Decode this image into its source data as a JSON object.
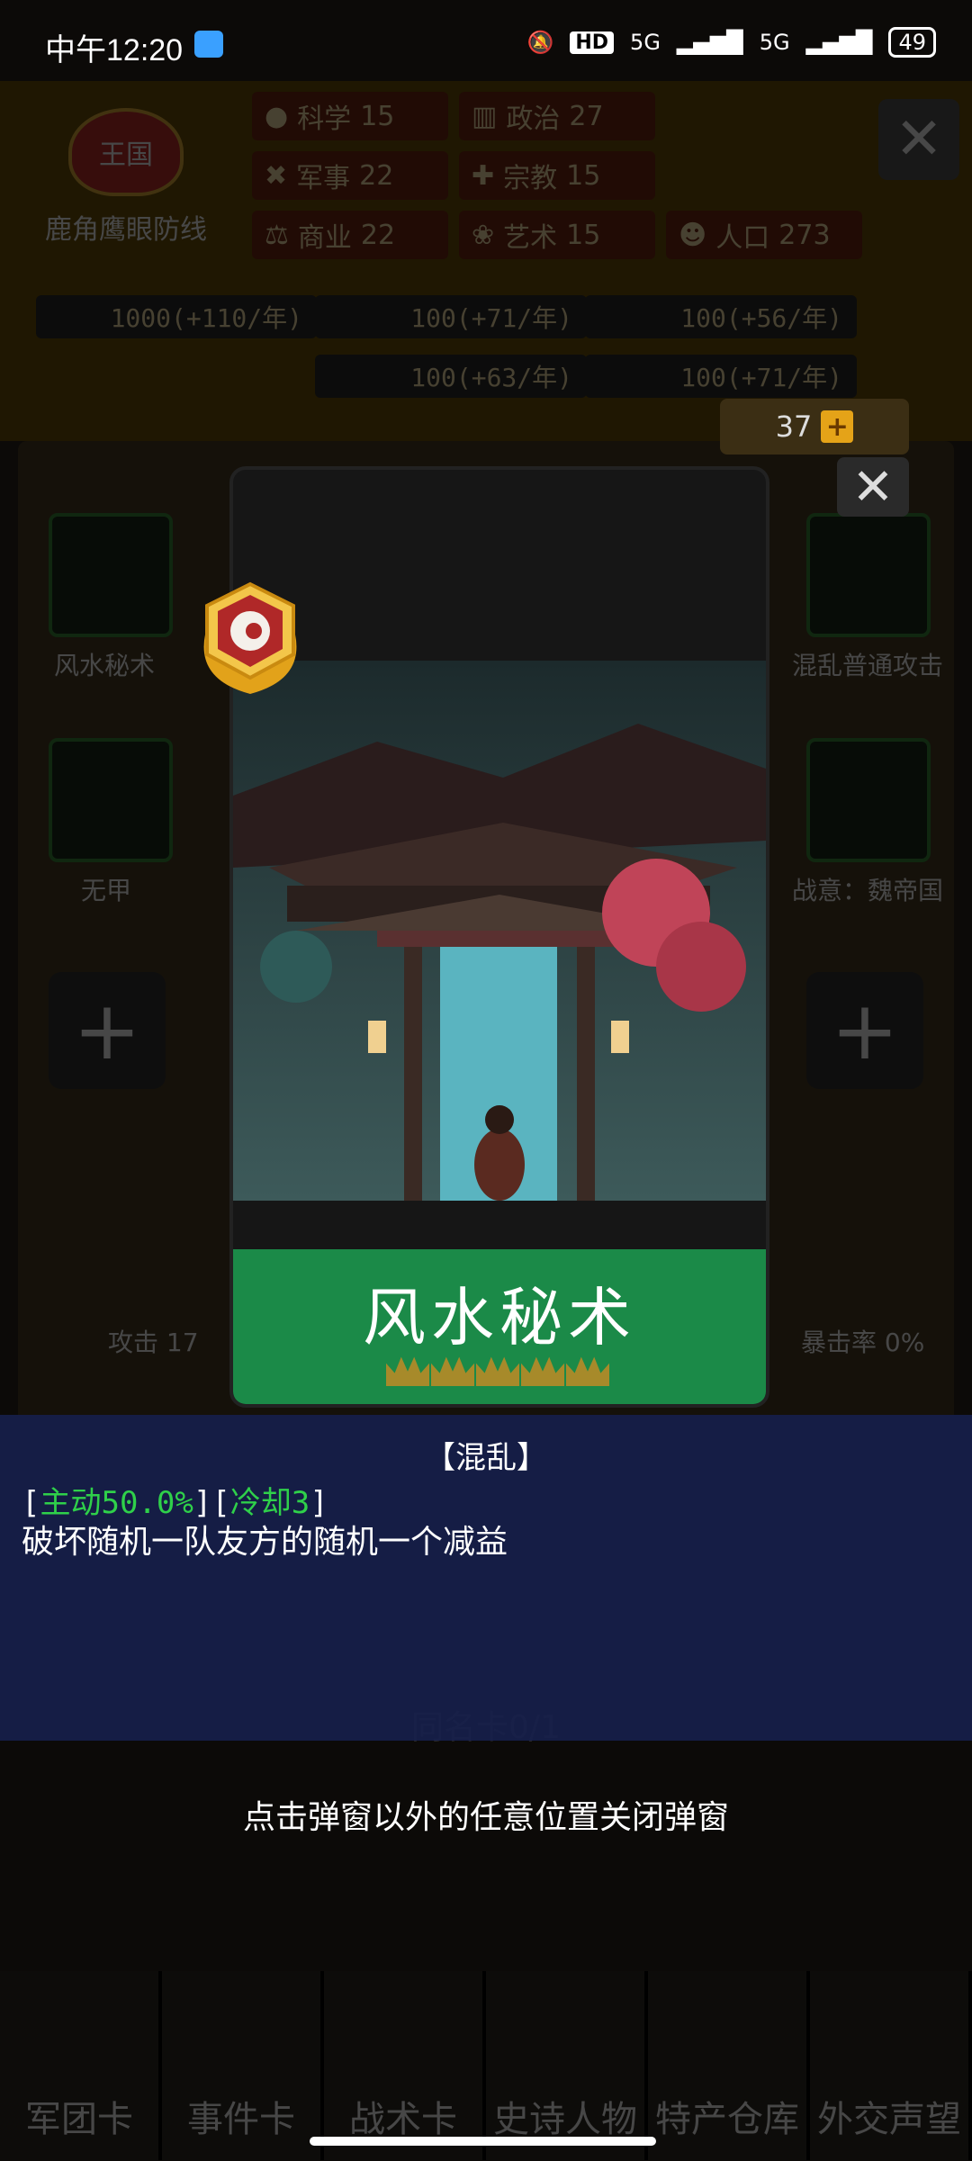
{
  "status": {
    "time": "中午12:20",
    "network1": "5G",
    "network2": "5G",
    "hd": "HD",
    "battery": "49"
  },
  "kingdom": {
    "badge": "王国",
    "name": "鹿角鹰眼防线"
  },
  "stats": [
    {
      "label": "科学",
      "value": "15",
      "icon": "planet-icon"
    },
    {
      "label": "政治",
      "value": "27",
      "icon": "pillar-icon"
    },
    {
      "label": "军事",
      "value": "22",
      "icon": "crossed-tools-icon"
    },
    {
      "label": "宗教",
      "value": "15",
      "icon": "cross-icon"
    },
    {
      "label": "商业",
      "value": "22",
      "icon": "scale-icon"
    },
    {
      "label": "艺术",
      "value": "15",
      "icon": "lotus-icon"
    },
    {
      "label": "人口",
      "value": "273",
      "icon": "person-icon"
    }
  ],
  "resources": [
    "1000(+110/年)",
    "100(+71/年)",
    "100(+56/年)",
    "100(+63/年)",
    "100(+71/年)"
  ],
  "counter": {
    "value": "37"
  },
  "slots": {
    "left_top": "风水秘术",
    "left_mid": "无甲",
    "right_top": "混乱普通攻击",
    "right_mid": "战意：魏帝国"
  },
  "stat_row": {
    "attack": "攻击 17",
    "crit": "暴击率 0%"
  },
  "card": {
    "name": "风水秘术",
    "stars": 5
  },
  "description": {
    "tag": "【混乱】",
    "active": "主动50.0%",
    "cooldown": "冷却3",
    "text": "破坏随机一队友方的随机一个减益"
  },
  "hint": "点击弹窗以外的任意位置关闭弹窗",
  "bg_hint": "同名卡0/1",
  "nav": [
    "军团卡",
    "事件卡",
    "战术卡",
    "史诗人物",
    "特产仓库",
    "外交声望"
  ]
}
